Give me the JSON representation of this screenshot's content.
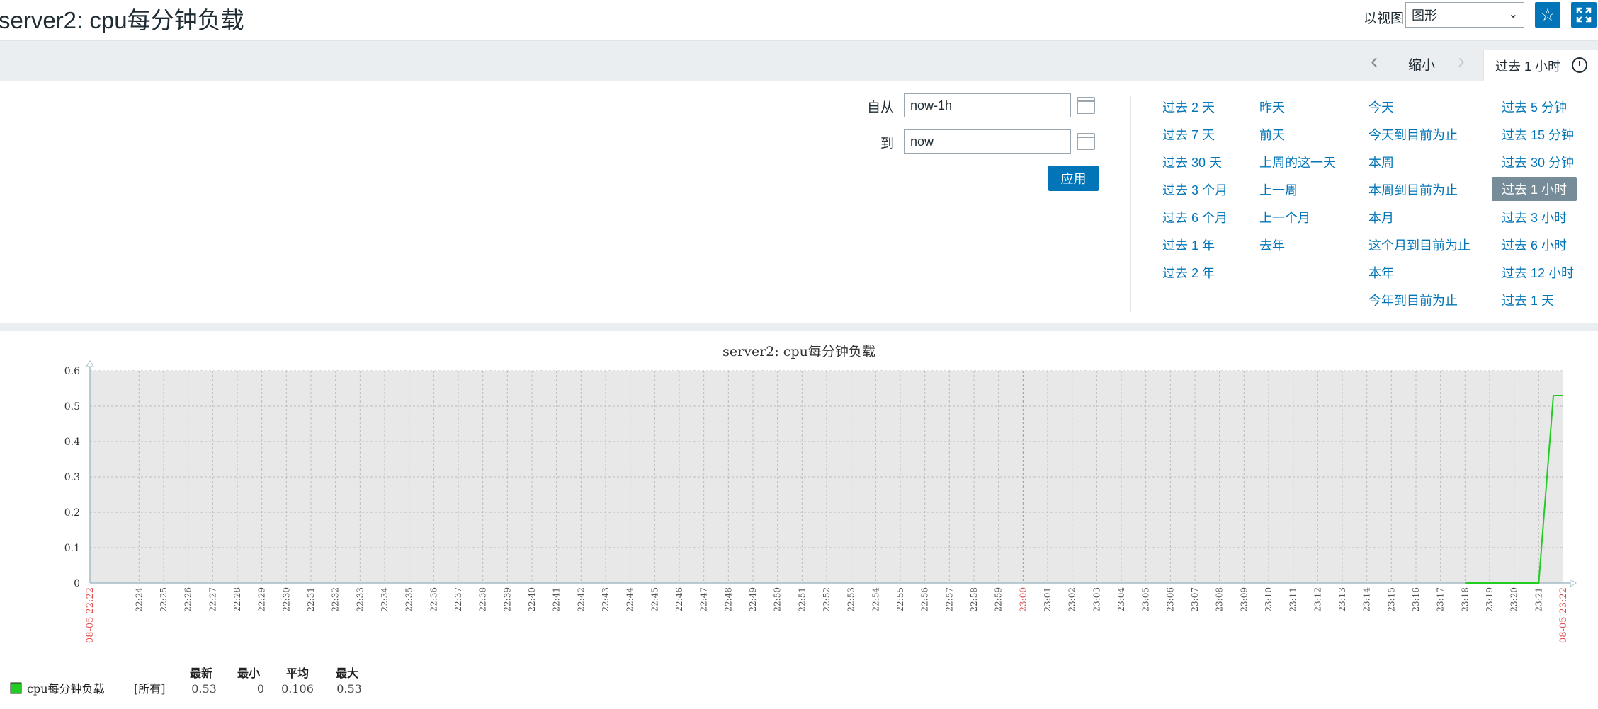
{
  "header": {
    "title": "server2: cpu每分钟负载",
    "view_label": "以视图",
    "view_select": "图形"
  },
  "tabbar": {
    "zoom_out": "缩小",
    "time_tab": "过去 1 小时"
  },
  "filter": {
    "from_label": "自从",
    "from_value": "now-1h",
    "to_label": "到",
    "to_value": "now",
    "apply": "应用",
    "quick": [
      [
        "过去 2 天",
        "过去 7 天",
        "过去 30 天",
        "过去 3 个月",
        "过去 6 个月",
        "过去 1 年",
        "过去 2 年"
      ],
      [
        "昨天",
        "前天",
        "上周的这一天",
        "上一周",
        "上一个月",
        "去年"
      ],
      [
        "今天",
        "今天到目前为止",
        "本周",
        "本周到目前为止",
        "本月",
        "这个月到目前为止",
        "本年",
        "今年到目前为止"
      ],
      [
        "过去 5 分钟",
        "过去 15 分钟",
        "过去 30 分钟",
        "过去 1 小时",
        "过去 3 小时",
        "过去 6 小时",
        "过去 12 小时",
        "过去 1 天"
      ]
    ],
    "selected": "过去 1 小时"
  },
  "chart_data": {
    "type": "line",
    "title": "server2:  cpu每分钟负载",
    "ylim": [
      0,
      0.6
    ],
    "yticks": [
      "0",
      "0.1",
      "0.2",
      "0.3",
      "0.4",
      "0.5",
      "0.6"
    ],
    "xticks": [
      "22:22",
      "22:24",
      "22:25",
      "22:26",
      "22:27",
      "22:28",
      "22:29",
      "22:30",
      "22:31",
      "22:32",
      "22:33",
      "22:34",
      "22:35",
      "22:36",
      "22:37",
      "22:38",
      "22:39",
      "22:40",
      "22:41",
      "22:42",
      "22:43",
      "22:44",
      "22:45",
      "22:46",
      "22:47",
      "22:48",
      "22:49",
      "22:50",
      "22:51",
      "22:52",
      "22:53",
      "22:54",
      "22:55",
      "22:56",
      "22:57",
      "22:58",
      "22:59",
      "23:00",
      "23:01",
      "23:02",
      "23:03",
      "23:04",
      "23:05",
      "23:06",
      "23:07",
      "23:08",
      "23:09",
      "23:10",
      "23:11",
      "23:12",
      "23:13",
      "23:14",
      "23:15",
      "23:16",
      "23:17",
      "23:18",
      "23:19",
      "23:20",
      "23:21",
      "23:22"
    ],
    "start_label": "08-05 22:22",
    "end_label": "08-05 23:22",
    "series": [
      {
        "name": "cpu每分钟负载",
        "color": "#22cc22",
        "x": [
          "23:18",
          "23:19",
          "23:20",
          "23:21",
          "23:22",
          "23:22"
        ],
        "values": [
          0,
          0,
          0,
          0,
          0.53,
          0.53
        ]
      }
    ],
    "legend": {
      "headers": [
        "最新",
        "最小",
        "平均",
        "最大"
      ],
      "scope": "[所有]",
      "values": [
        "0.53",
        "0",
        "0.106",
        "0.53"
      ]
    },
    "grid": true
  }
}
